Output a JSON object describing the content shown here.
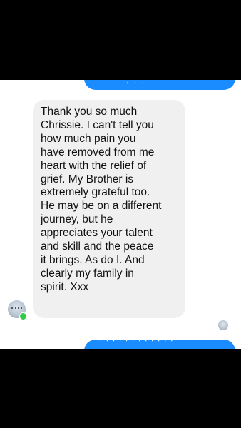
{
  "colors": {
    "background": "#000000",
    "chat_background": "#ffffff",
    "incoming_bubble": "#f1f0f0",
    "outgoing_bubble": "#1a8cff",
    "online_indicator": "#31cc46"
  },
  "messages": {
    "outgoing_top": {
      "text_fragment": "' ' '"
    },
    "incoming": {
      "text": "Thank you so much\nChrissie. I can't tell you\nhow much pain you\nhave removed from me\nheart with the relief of\ngrief. My Brother is\nextremely grateful too.\nHe may be on a different\njourney, but he\nappreciates your talent\nand skill and the peace\nit brings. As do I. And\nclearly my family in\nspirit. Xxx"
    },
    "outgoing_bottom": {
      "text_fragment": "' ' ' ' ' ' ' '  ' ' ' '"
    }
  },
  "icons": {
    "sender_avatar": "avatar-icon",
    "online_status": "online-dot-icon",
    "read_receipt": "read-receipt-avatar-icon"
  }
}
